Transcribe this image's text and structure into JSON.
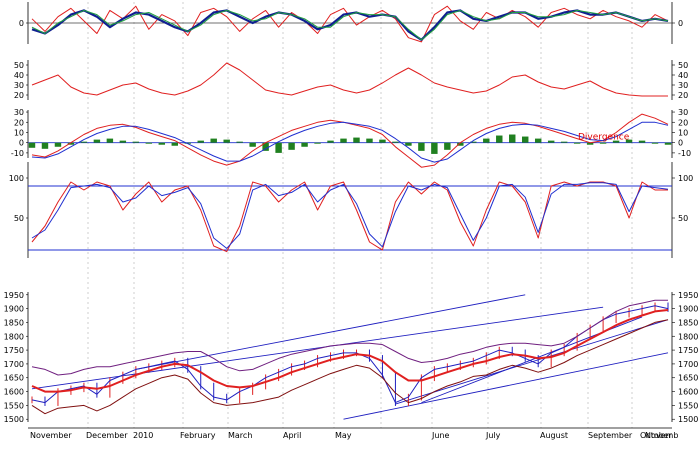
{
  "chart_data": [
    {
      "type": "line",
      "panel": "oscillator",
      "right_ticks": [
        "0"
      ],
      "left_ticks": [
        "0"
      ],
      "ylim": [
        -1,
        1
      ],
      "series": [
        {
          "values": [
            0.2,
            -0.4,
            0.3,
            0.7,
            0.1,
            -0.5,
            0.6,
            0.2,
            0.8,
            -0.3,
            0.4,
            0.1,
            -0.6,
            0.5,
            0.7,
            0.3,
            -0.4,
            0.2,
            0.6,
            -0.2,
            0.5,
            0.1,
            -0.5,
            0.4,
            0.7,
            -0.1,
            0.3,
            0.6,
            0.2,
            -0.7,
            -0.9,
            0.4,
            0.8,
            0.1,
            -0.3,
            0.5,
            0.2,
            0.6,
            0.3,
            -0.2,
            0.5,
            0.7,
            0.4,
            0.2,
            0.6,
            0.3,
            0.1,
            -0.2,
            0.4,
            0.1
          ],
          "color": "#e02020"
        },
        {
          "values": [
            -0.3,
            -0.5,
            -0.1,
            0.4,
            0.6,
            0.3,
            -0.2,
            0.2,
            0.5,
            0.4,
            0.1,
            -0.2,
            -0.4,
            0.0,
            0.5,
            0.6,
            0.3,
            0.0,
            0.3,
            0.5,
            0.4,
            0.1,
            -0.3,
            -0.1,
            0.4,
            0.5,
            0.3,
            0.4,
            0.3,
            -0.4,
            -0.8,
            -0.2,
            0.5,
            0.6,
            0.2,
            0.1,
            0.3,
            0.5,
            0.5,
            0.2,
            0.3,
            0.5,
            0.6,
            0.4,
            0.4,
            0.5,
            0.3,
            0.1,
            0.2,
            0.1
          ],
          "color": "#102090"
        },
        {
          "values": [
            -0.2,
            -0.5,
            0.0,
            0.3,
            0.6,
            0.4,
            -0.1,
            0.1,
            0.4,
            0.5,
            0.2,
            -0.1,
            -0.4,
            -0.1,
            0.4,
            0.6,
            0.4,
            0.1,
            0.2,
            0.5,
            0.4,
            0.2,
            -0.2,
            -0.2,
            0.3,
            0.5,
            0.4,
            0.4,
            0.3,
            -0.3,
            -0.8,
            -0.3,
            0.4,
            0.6,
            0.3,
            0.1,
            0.2,
            0.5,
            0.5,
            0.3,
            0.3,
            0.4,
            0.6,
            0.5,
            0.4,
            0.5,
            0.3,
            0.1,
            0.2,
            0.1
          ],
          "color": "#20a040"
        }
      ]
    },
    {
      "type": "line",
      "panel": "adx",
      "right_ticks": [
        "50",
        "40",
        "30",
        "20"
      ],
      "left_ticks": [
        "50",
        "40",
        "30",
        "20"
      ],
      "ylim": [
        15,
        55
      ],
      "series": [
        {
          "values": [
            30,
            35,
            40,
            28,
            22,
            20,
            25,
            30,
            32,
            26,
            22,
            20,
            24,
            30,
            40,
            52,
            45,
            35,
            25,
            22,
            20,
            24,
            28,
            30,
            25,
            22,
            25,
            32,
            40,
            47,
            40,
            32,
            28,
            25,
            22,
            24,
            30,
            38,
            40,
            33,
            28,
            26,
            30,
            34,
            27,
            22,
            20,
            19,
            19,
            19
          ],
          "color": "#e02020"
        }
      ]
    },
    {
      "type": "bar",
      "panel": "macd",
      "right_ticks": [
        "30",
        "20",
        "10",
        "0",
        "-10"
      ],
      "left_ticks": [
        "30",
        "20",
        "10",
        "0",
        "-10"
      ],
      "ylim": [
        -15,
        32
      ],
      "histogram": [
        -5,
        -6,
        -4,
        -2,
        1,
        3,
        4,
        2,
        1,
        -1,
        -2,
        -3,
        -1,
        2,
        4,
        3,
        1,
        -4,
        -8,
        -10,
        -7,
        -4,
        -1,
        2,
        4,
        5,
        4,
        3,
        1,
        -3,
        -8,
        -11,
        -7,
        -3,
        1,
        4,
        7,
        8,
        6,
        4,
        2,
        1,
        -1,
        -2,
        -1,
        2,
        3,
        2,
        -1,
        -2
      ],
      "series": [
        {
          "values": [
            -12,
            -14,
            -8,
            0,
            8,
            14,
            17,
            18,
            15,
            10,
            6,
            2,
            -5,
            -12,
            -18,
            -22,
            -18,
            -8,
            0,
            6,
            12,
            16,
            20,
            22,
            20,
            17,
            14,
            8,
            -4,
            -14,
            -24,
            -22,
            -12,
            0,
            8,
            14,
            18,
            20,
            19,
            16,
            12,
            8,
            4,
            0,
            2,
            10,
            20,
            28,
            24,
            18
          ],
          "color": "#e02020"
        },
        {
          "values": [
            -14,
            -15,
            -11,
            -4,
            3,
            9,
            13,
            16,
            16,
            13,
            9,
            5,
            -1,
            -7,
            -13,
            -18,
            -18,
            -13,
            -6,
            1,
            7,
            12,
            16,
            19,
            20,
            18,
            16,
            12,
            4,
            -5,
            -15,
            -19,
            -16,
            -7,
            2,
            9,
            14,
            17,
            18,
            17,
            14,
            11,
            7,
            3,
            2,
            6,
            13,
            20,
            20,
            17
          ],
          "color": "#2030d0"
        }
      ],
      "annotation": "Divergence"
    },
    {
      "type": "line",
      "panel": "stochastic",
      "right_ticks": [
        "100",
        "50"
      ],
      "left_ticks": [
        "100",
        "50"
      ],
      "ylim": [
        0,
        120
      ],
      "hlines": [
        90,
        10
      ],
      "series": [
        {
          "values": [
            20,
            40,
            70,
            95,
            85,
            95,
            90,
            60,
            80,
            95,
            70,
            85,
            90,
            60,
            15,
            8,
            40,
            95,
            90,
            70,
            85,
            95,
            60,
            90,
            95,
            60,
            20,
            10,
            70,
            95,
            80,
            95,
            85,
            45,
            15,
            60,
            95,
            90,
            70,
            25,
            90,
            95,
            90,
            95,
            95,
            90,
            50,
            95,
            85,
            85
          ],
          "color": "#e02020"
        },
        {
          "values": [
            25,
            35,
            60,
            88,
            90,
            92,
            88,
            70,
            75,
            90,
            78,
            82,
            88,
            68,
            25,
            12,
            30,
            85,
            92,
            78,
            82,
            92,
            70,
            85,
            92,
            68,
            30,
            14,
            58,
            90,
            85,
            92,
            88,
            55,
            22,
            50,
            90,
            92,
            76,
            32,
            80,
            92,
            92,
            94,
            94,
            92,
            58,
            90,
            88,
            86
          ],
          "color": "#2030d0"
        }
      ]
    },
    {
      "type": "line",
      "panel": "price",
      "right_ticks": [
        "1950",
        "1900",
        "1850",
        "1800",
        "1750",
        "1700",
        "1650",
        "1600",
        "1550",
        "1500"
      ],
      "left_ticks": [
        "1950",
        "1900",
        "1850",
        "1800",
        "1750",
        "1700",
        "1650",
        "1600",
        "1550",
        "1500"
      ],
      "ylim": [
        1490,
        1960
      ],
      "x_labels": [
        "November",
        "December",
        "2010",
        "February",
        "March",
        "April",
        "May",
        "June",
        "July",
        "August",
        "September",
        "October",
        "Novemb"
      ],
      "series": [
        {
          "name": "",
          "values": [
            1570,
            1560,
            1600,
            1610,
            1620,
            1590,
            1640,
            1660,
            1680,
            1690,
            1700,
            1710,
            1680,
            1620,
            1580,
            1570,
            1600,
            1620,
            1650,
            1670,
            1690,
            1700,
            1720,
            1730,
            1740,
            1740,
            1720,
            1660,
            1560,
            1580,
            1650,
            1680,
            1690,
            1700,
            1710,
            1730,
            1750,
            1740,
            1720,
            1700,
            1740,
            1760,
            1800,
            1830,
            1860,
            1880,
            1890,
            1900,
            1910,
            1900
          ],
          "color": "#2020c0"
        },
        {
          "name": "",
          "values": [
            1620,
            1600,
            1600,
            1605,
            1615,
            1610,
            1620,
            1640,
            1660,
            1675,
            1690,
            1700,
            1695,
            1670,
            1640,
            1620,
            1615,
            1620,
            1635,
            1650,
            1670,
            1685,
            1700,
            1715,
            1725,
            1735,
            1730,
            1710,
            1670,
            1640,
            1640,
            1655,
            1670,
            1685,
            1700,
            1710,
            1725,
            1735,
            1730,
            1720,
            1725,
            1740,
            1765,
            1790,
            1815,
            1840,
            1860,
            1875,
            1890,
            1895
          ],
          "color": "#e02020"
        },
        {
          "name": "",
          "values": [
            1690,
            1680,
            1660,
            1665,
            1680,
            1690,
            1690,
            1700,
            1710,
            1720,
            1730,
            1740,
            1745,
            1745,
            1720,
            1690,
            1675,
            1680,
            1700,
            1720,
            1735,
            1745,
            1755,
            1765,
            1770,
            1775,
            1775,
            1770,
            1745,
            1720,
            1705,
            1710,
            1720,
            1735,
            1745,
            1760,
            1770,
            1775,
            1775,
            1770,
            1765,
            1775,
            1800,
            1830,
            1860,
            1890,
            1910,
            1920,
            1930,
            1930
          ],
          "color": "#702080"
        },
        {
          "name": "",
          "values": [
            1550,
            1520,
            1540,
            1545,
            1550,
            1530,
            1550,
            1580,
            1610,
            1630,
            1650,
            1660,
            1645,
            1595,
            1560,
            1550,
            1555,
            1560,
            1570,
            1580,
            1605,
            1625,
            1645,
            1665,
            1680,
            1695,
            1685,
            1650,
            1595,
            1560,
            1575,
            1600,
            1620,
            1635,
            1655,
            1660,
            1680,
            1695,
            1685,
            1670,
            1685,
            1705,
            1730,
            1750,
            1770,
            1790,
            1810,
            1830,
            1850,
            1860
          ],
          "color": "#801010"
        }
      ],
      "trendlines": [
        {
          "from": [
            8,
            1680
          ],
          "to": [
            38,
            1950
          ],
          "color": "#2020c0"
        },
        {
          "from": [
            0,
            1610
          ],
          "to": [
            44,
            1905
          ],
          "color": "#2020c0"
        },
        {
          "from": [
            24,
            1500
          ],
          "to": [
            49,
            1740
          ],
          "color": "#2020c0"
        },
        {
          "from": [
            28,
            1555
          ],
          "to": [
            49,
            1860
          ],
          "color": "#2020c0"
        },
        {
          "from": [
            30,
            1560
          ],
          "to": [
            47,
            1870
          ],
          "color": "#2020c0"
        }
      ]
    }
  ]
}
